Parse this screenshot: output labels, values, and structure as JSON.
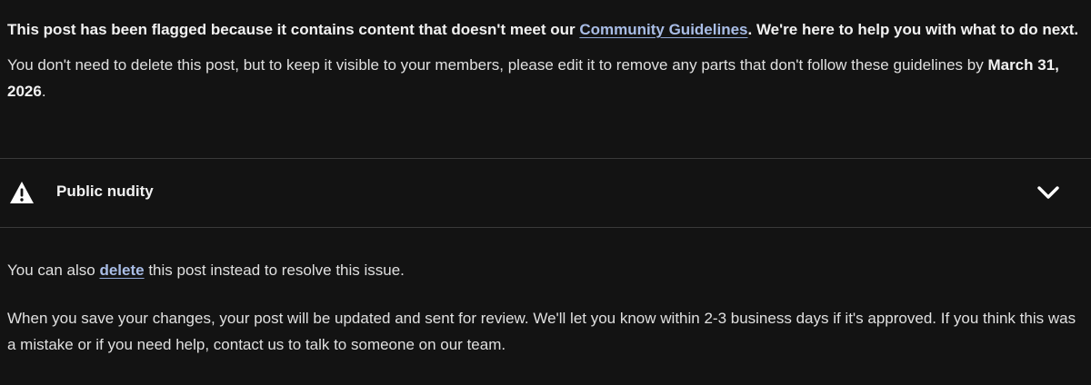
{
  "notice": {
    "flag_prefix": "This post has been flagged because it contains content that doesn't meet our ",
    "guidelines_link": "Community Guidelines",
    "flag_suffix": ". We're here to help you with what to do next.",
    "visible_prefix": "You don't need to delete this post, but to keep it visible to your members, please edit it to remove any parts that don't follow these guidelines by ",
    "deadline": "March 31, 2026",
    "visible_suffix": "."
  },
  "violation": {
    "icon": "warning-icon",
    "title": "Public nudity",
    "toggle_icon": "chevron-down-icon"
  },
  "footer": {
    "delete_prefix": "You can also ",
    "delete_link": "delete",
    "delete_suffix": " this post instead to resolve this issue.",
    "review_text": "When you save your changes, your post will be updated and sent for review. We'll let you know within 2-3 business days if it's approved. If you think this was a mistake or if you need help, contact us to talk to someone on our team."
  },
  "colors": {
    "background": "#131313",
    "text": "#e6e6e6",
    "link": "#a9bde6",
    "divider": "#3a3a3a"
  }
}
